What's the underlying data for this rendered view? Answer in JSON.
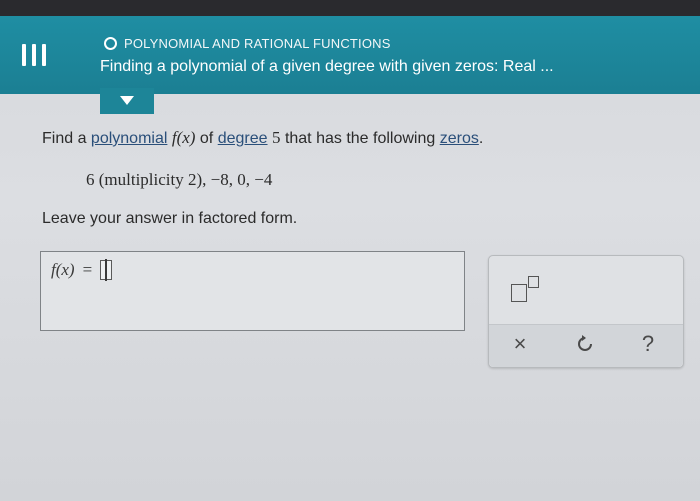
{
  "header": {
    "topic": "POLYNOMIAL AND RATIONAL FUNCTIONS",
    "title": "Finding a polynomial of a given degree with given zeros: Real ..."
  },
  "question": {
    "prefix": "Find a ",
    "link_polynomial": "polynomial",
    "function": "f(x)",
    "of_text": "of",
    "link_degree": "degree",
    "degree_value": "5",
    "middle": "that has the following",
    "link_zeros": "zeros",
    "period": ".",
    "zeros_list": "6 (multiplicity 2),  −8,  0,  −4",
    "instruction": "Leave your answer in factored form."
  },
  "answer": {
    "lhs": "f(x)",
    "equals": "=",
    "value": ""
  },
  "tools": {
    "clear_symbol": "×",
    "help_symbol": "?"
  },
  "colors": {
    "header": "#1f8ea3",
    "link": "#2a4f7a"
  }
}
